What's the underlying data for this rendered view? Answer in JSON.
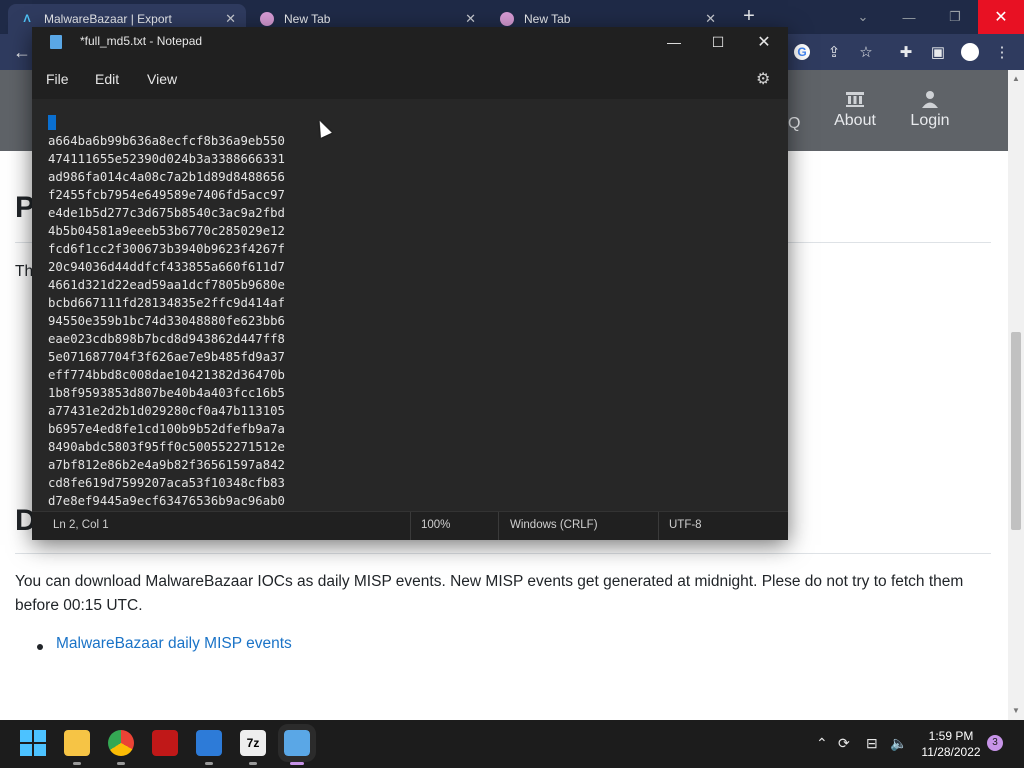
{
  "browser": {
    "tabs": [
      {
        "title": "MalwareBazaar | Export",
        "active": true
      },
      {
        "title": "New Tab",
        "active": false
      },
      {
        "title": "New Tab",
        "active": false
      }
    ]
  },
  "site": {
    "nav": [
      {
        "label": "About",
        "icon": "bank-icon"
      },
      {
        "label": "Login",
        "icon": "user-icon"
      }
    ],
    "partial_nav_text": "Q",
    "heading_fragment_1": "P",
    "text_fragment": "Th",
    "heading_fragment_2": "D",
    "misp_paragraph": "You can download MalwareBazaar IOCs as daily MISP events. New MISP events get generated at midnight. Plese do not try to fetch them before 00:15 UTC.",
    "misp_link": "MalwareBazaar daily MISP events"
  },
  "notepad": {
    "title": "*full_md5.txt - Notepad",
    "menu": [
      "File",
      "Edit",
      "View"
    ],
    "lines": [
      "a664ba6b99b636a8ecfcf8b36a9eb550",
      "474111655e52390d024b3a3388666331",
      "ad986fa014c4a08c7a2b1d89d8488656",
      "f2455fcb7954e649589e7406fd5acc97",
      "e4de1b5d277c3d675b8540c3ac9a2fbd",
      "4b5b04581a9eeeb53b6770c285029e12",
      "fcd6f1cc2f300673b3940b9623f4267f",
      "20c94036d44ddfcf433855a660f611d7",
      "4661d321d22ead59aa1dcf7805b9680e",
      "bcbd667111fd28134835e2ffc9d414af",
      "94550e359b1bc74d33048880fe623bb6",
      "eae023cdb898b7bcd8d943862d447ff8",
      "5e071687704f3f626ae7e9b485fd9a37",
      "eff774bbd8c008dae10421382d36470b",
      "1b8f9593853d807be40b4a403fcc16b5",
      "a77431e2d2b1d029280cf0a47b113105",
      "b6957e4ed8fe1cd100b9b52dfefb9a7a",
      "8490abdc5803f95ff0c500552271512e",
      "a7bf812e86b2e4a9b82f36561597a842",
      "cd8fe619d7599207aca53f10348cfb83",
      "d7e8ef9445a9ecf63476536b9ac96ab0"
    ],
    "status": {
      "position": "Ln 2, Col 1",
      "zoom": "100%",
      "line_ending": "Windows (CRLF)",
      "encoding": "UTF-8"
    }
  },
  "taskbar": {
    "time": "1:59 PM",
    "date": "11/28/2022",
    "notification_count": "3",
    "apps": [
      "start-icon",
      "file-explorer-icon",
      "chrome-icon",
      "mcafee-icon",
      "photos-icon",
      "7zip-icon",
      "notepad-icon"
    ]
  },
  "colors": {
    "tabstrip": "#1f2a47",
    "toolbar": "#2f3b5f",
    "site_nav": "#5f6368",
    "link": "#1a73c7",
    "notepad_bg": "#272727",
    "selection": "#0a6fd0",
    "taskbar": "#1c1c1c",
    "close_red": "#e81123"
  }
}
